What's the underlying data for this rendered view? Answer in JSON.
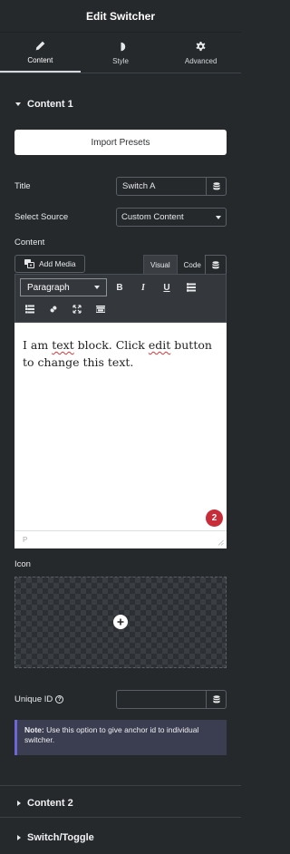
{
  "header": {
    "title": "Edit Switcher"
  },
  "tabs": [
    {
      "label": "Content",
      "icon": "pencil-icon",
      "active": true
    },
    {
      "label": "Style",
      "icon": "contrast-icon",
      "active": false
    },
    {
      "label": "Advanced",
      "icon": "gear-icon",
      "active": false
    }
  ],
  "section1": {
    "title": "Content 1"
  },
  "import_button": "Import Presets",
  "fields": {
    "title_label": "Title",
    "title_value": "Switch A",
    "source_label": "Select Source",
    "source_value": "Custom Content",
    "content_label": "Content"
  },
  "editor": {
    "add_media": "Add Media",
    "tab_visual": "Visual",
    "tab_code": "Code",
    "format_value": "Paragraph",
    "bold": "B",
    "italic": "I",
    "underline": "U",
    "text_part1": "I am ",
    "text_spell1": "text",
    "text_part2": " block. Click ",
    "text_spell2": "edit",
    "text_part3": " button to change this text.",
    "notification_count": "2",
    "status_path": "P"
  },
  "icon_field": {
    "label": "Icon"
  },
  "unique_id": {
    "label": "Unique ID",
    "help": "?",
    "value": ""
  },
  "note": {
    "prefix": "Note:",
    "text": " Use this option to give anchor id to individual switcher."
  },
  "section2": {
    "title": "Content 2"
  },
  "section3": {
    "title": "Switch/Toggle"
  },
  "colors": {
    "background": "#26292c",
    "note_accent": "#6c66d9",
    "badge": "#c92c39"
  }
}
